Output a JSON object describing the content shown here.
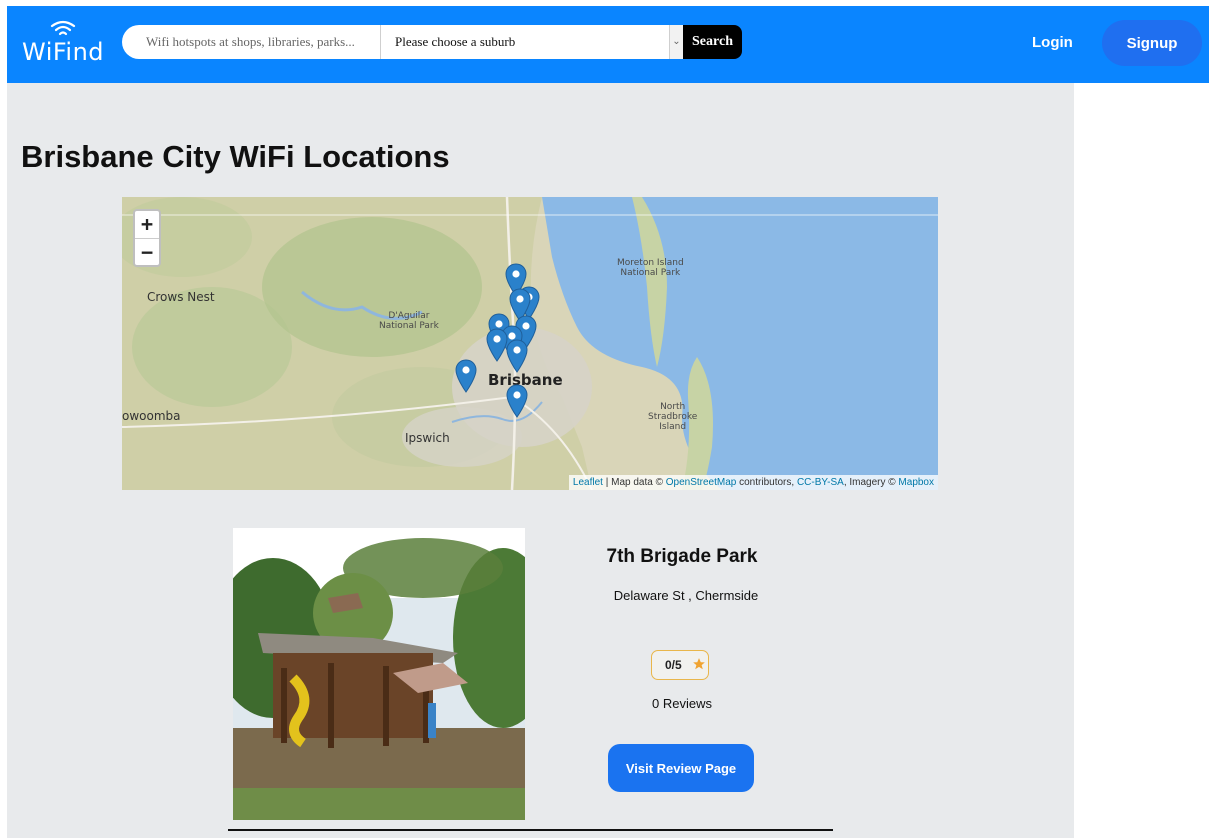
{
  "header": {
    "logo_text": "WiFind",
    "search_placeholder": "Wifi hotspots at shops, libraries, parks...",
    "suburb_select": "Please choose a suburb",
    "search_label": "Search",
    "login_label": "Login",
    "signup_label": "Signup",
    "brand_color": "#0a85ff"
  },
  "main": {
    "title": "Brisbane City WiFi Locations"
  },
  "map": {
    "zoom_in": "+",
    "zoom_out": "−",
    "labels": {
      "moreton": "Moreton Island\nNational Park",
      "crows_nest": "Crows Nest",
      "daguilar": "D'Aguilar\nNational Park",
      "brisbane": "Brisbane",
      "toowoomba": "owoomba",
      "ipswich": "Ipswich",
      "stradbroke": "North\nStradbroke\nIsland"
    },
    "attribution": {
      "leaflet": "Leaflet",
      "map_data": "| Map data ©",
      "osm": "OpenStreetMap",
      "contributors": "contributors,",
      "license": "CC-BY-SA",
      "imagery": ", Imagery ©",
      "mapbox": "Mapbox"
    },
    "marker_color": "#2a81cb"
  },
  "listing": {
    "name": "7th Brigade Park",
    "address": "Delaware St , Chermside",
    "rating": "0/5",
    "reviews": "0 Reviews",
    "review_button": "Visit Review Page",
    "star_color": "#f0a330"
  }
}
